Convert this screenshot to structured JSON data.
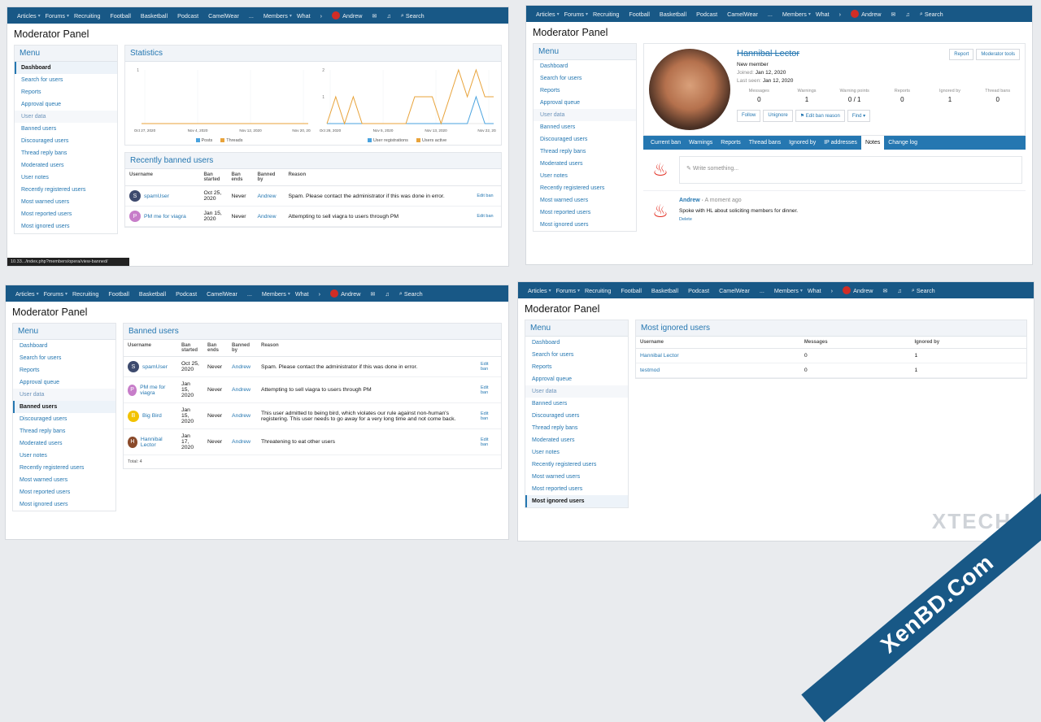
{
  "nav": {
    "items": [
      "Articles",
      "Forums",
      "Recruiting",
      "Football",
      "Basketball",
      "Podcast",
      "CamelWear",
      "...",
      "Members",
      "What"
    ],
    "user": "Andrew",
    "search": "Search"
  },
  "page_title": "Moderator Panel",
  "menu": {
    "heading": "Menu",
    "items": [
      "Dashboard",
      "Search for users",
      "Reports",
      "Approval queue",
      "User data",
      "Banned users",
      "Discouraged users",
      "Thread reply bans",
      "Moderated users",
      "User notes",
      "Recently registered users",
      "Most warned users",
      "Most reported users",
      "Most ignored users"
    ]
  },
  "q1": {
    "stats_title": "Statistics",
    "chart_data": [
      {
        "type": "line",
        "x": [
          "Oct 27, 2020",
          "Nov 4, 2020",
          "Nov 12, 2020",
          "Nov 20, 2020"
        ],
        "series": [
          {
            "name": "Posts",
            "values": [
              0,
              0,
              0,
              0,
              0,
              0,
              0,
              0,
              0,
              0,
              0,
              0,
              0,
              0,
              0,
              0,
              0,
              0,
              0,
              0
            ]
          },
          {
            "name": "Threads",
            "values": [
              0,
              0,
              0,
              0,
              0,
              0,
              0,
              0,
              0,
              0,
              0,
              0,
              0,
              0,
              0,
              0,
              0,
              0,
              0,
              0
            ]
          }
        ],
        "ylim": [
          0,
          1
        ],
        "yticks": [
          "1"
        ]
      },
      {
        "type": "line",
        "x": [
          "Oct 28, 2020",
          "Nov 5, 2020",
          "Nov 13, 2020",
          "Nov 22, 2020"
        ],
        "series": [
          {
            "name": "User registrations",
            "values": [
              0,
              0,
              0,
              0,
              0,
              0,
              0,
              0,
              0,
              0,
              0,
              0,
              0,
              0,
              0,
              0,
              0,
              1,
              0,
              0
            ]
          },
          {
            "name": "Users active",
            "values": [
              0,
              1,
              0,
              1,
              0,
              0,
              0,
              0,
              0,
              0,
              1,
              1,
              1,
              0,
              1,
              2,
              1,
              2,
              1,
              1
            ]
          }
        ],
        "ylim": [
          0,
          2
        ],
        "yticks": [
          "2",
          "1"
        ]
      }
    ],
    "banned_title": "Recently banned users",
    "columns": [
      "Username",
      "Ban started",
      "Ban ends",
      "Banned by",
      "Reason"
    ],
    "rows": [
      {
        "user": "spamUser",
        "start": "Oct 25, 2020",
        "ends": "Never",
        "by": "Andrew",
        "reason": "Spam. Please contact the administrator if this was done in error.",
        "action": "Edit ban",
        "initial": "S",
        "color": "#3d4a6e"
      },
      {
        "user": "PM me for viagra",
        "start": "Jan 15, 2020",
        "ends": "Never",
        "by": "Andrew",
        "reason": "Attempting to sell viagra to users through PM",
        "action": "Edit ban",
        "initial": "P",
        "color": "#c77dc9"
      }
    ],
    "status_url": "10.33.../index.php?members/opera/view-banned/"
  },
  "q2": {
    "name": "Hannibal Lector",
    "title": "New member",
    "joined_label": "Joined:",
    "joined": "Jan 12, 2020",
    "lastseen_label": "Last seen:",
    "lastseen": "Jan 12, 2020",
    "report": "Report",
    "tools": "Moderator tools",
    "stats": [
      {
        "label": "Messages",
        "value": "0"
      },
      {
        "label": "Warnings",
        "value": "1"
      },
      {
        "label": "Warning points",
        "value": "0 / 1"
      },
      {
        "label": "Reports",
        "value": "0"
      },
      {
        "label": "Ignored by",
        "value": "1"
      },
      {
        "label": "Thread bans",
        "value": "0"
      }
    ],
    "buttons": [
      "Follow",
      "Unignore",
      "Edit ban reason",
      "Find"
    ],
    "tabs": [
      "Current ban",
      "Warnings",
      "Reports",
      "Thread bans",
      "Ignored by",
      "IP addresses",
      "Notes",
      "Change log"
    ],
    "note_placeholder": "Write something...",
    "note_author": "Andrew",
    "note_time": "A moment ago",
    "note_text": "Spoke with HL about soliciting members for dinner.",
    "note_delete": "Delete"
  },
  "q3": {
    "title": "Banned users",
    "columns": [
      "Username",
      "Ban started",
      "Ban ends",
      "Banned by",
      "Reason"
    ],
    "rows": [
      {
        "user": "spamUser",
        "start": "Oct 25, 2020",
        "ends": "Never",
        "by": "Andrew",
        "reason": "Spam. Please contact the administrator if this was done in error.",
        "action": "Edit ban",
        "initial": "S",
        "color": "#3d4a6e"
      },
      {
        "user": "PM me for viagra",
        "start": "Jan 15, 2020",
        "ends": "Never",
        "by": "Andrew",
        "reason": "Attempting to sell viagra to users through PM",
        "action": "Edit ban",
        "initial": "P",
        "color": "#c77dc9"
      },
      {
        "user": "Big Bird",
        "start": "Jan 15, 2020",
        "ends": "Never",
        "by": "Andrew",
        "reason": "This user admitted to being bird, which violates our rule against non-human's registering. This user needs to go away for a very long time and not come back.",
        "action": "Edit ban",
        "initial": "B",
        "color": "#f2c200"
      },
      {
        "user": "Hannibal Lector",
        "start": "Jan 17, 2020",
        "ends": "Never",
        "by": "Andrew",
        "reason": "Threatening to eat other users",
        "action": "Edit ban",
        "initial": "H",
        "color": "#8a4a2a"
      }
    ],
    "total": "Total: 4"
  },
  "q4": {
    "title": "Most ignored users",
    "columns": [
      "Username",
      "Messages",
      "Ignored by"
    ],
    "rows": [
      {
        "user": "Hannibal Lector",
        "messages": "0",
        "ignored": "1"
      },
      {
        "user": "testmod",
        "messages": "0",
        "ignored": "1"
      }
    ]
  },
  "watermark": "XenBD.Com",
  "watermark2": "XTECH"
}
